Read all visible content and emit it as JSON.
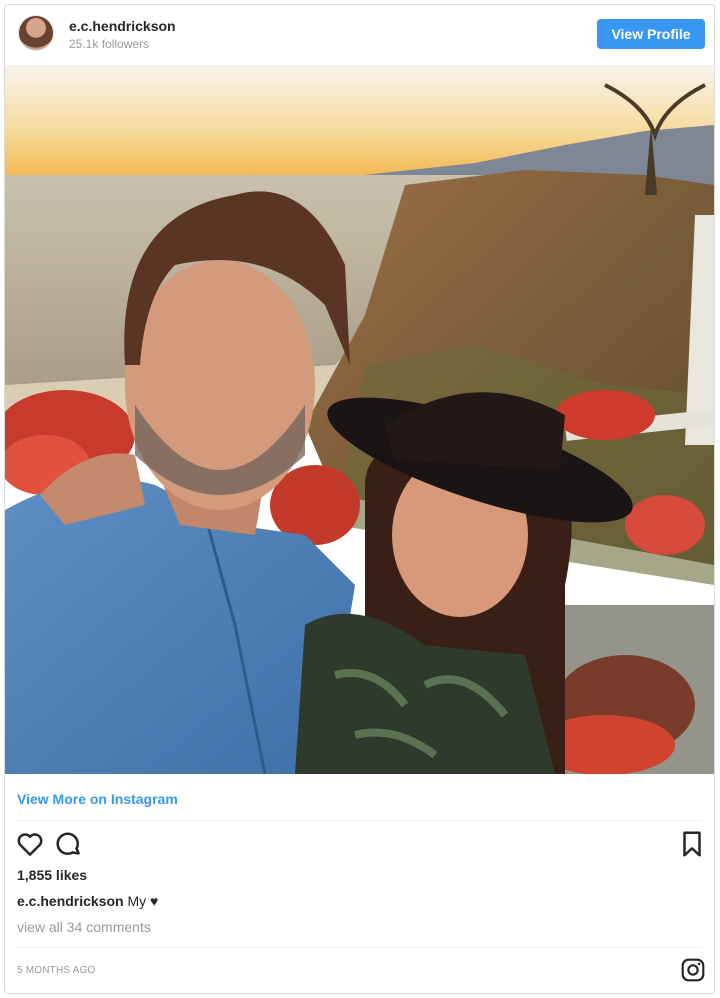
{
  "post": {
    "username": "e.c.hendrickson",
    "followers": "25.1k followers",
    "view_profile_label": "View Profile",
    "view_more_label": "View More on Instagram",
    "likes": "1,855 likes",
    "caption_user": "e.c.hendrickson",
    "caption_text": "My ♥",
    "comments_link": "view all 34 comments",
    "timestamp": "5 MONTHS AGO"
  },
  "icons": {
    "like": "heart-icon",
    "comment": "comment-icon",
    "save": "bookmark-icon",
    "brand": "instagram-icon"
  },
  "colors": {
    "accent": "#3897f0",
    "text": "#262626",
    "muted": "#999999",
    "border": "#dbdbdb"
  }
}
